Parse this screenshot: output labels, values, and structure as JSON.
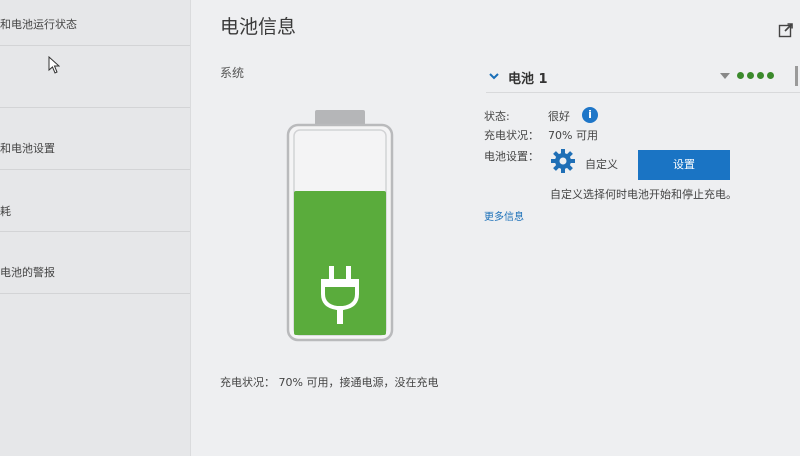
{
  "sidebar": {
    "items": [
      {
        "label": "和电池运行状态"
      },
      {
        "label": ""
      },
      {
        "label": "和电池设置"
      },
      {
        "label": "耗"
      },
      {
        "label": "电池的警报"
      }
    ]
  },
  "main": {
    "title": "电池信息",
    "system_label": "系统",
    "charge_status": "充电状况：   70% 可用，接通电源，没在充电",
    "battery_level": 0.7
  },
  "battery": {
    "name": "电池 1",
    "status_label": "状态:",
    "status_value": "很好",
    "info_icon": "i",
    "charge_label": "充电状况：",
    "charge_value": "70% 可用",
    "settings_label": "电池设置：",
    "settings_mode": "自定义",
    "settings_button": "设置",
    "settings_desc": "自定义选择何时电池开始和停止充电。",
    "more_info": "更多信息"
  },
  "colors": {
    "accent": "#1a74c4",
    "battery_fill": "#5aac3c",
    "signal": "#3b8a2c"
  }
}
